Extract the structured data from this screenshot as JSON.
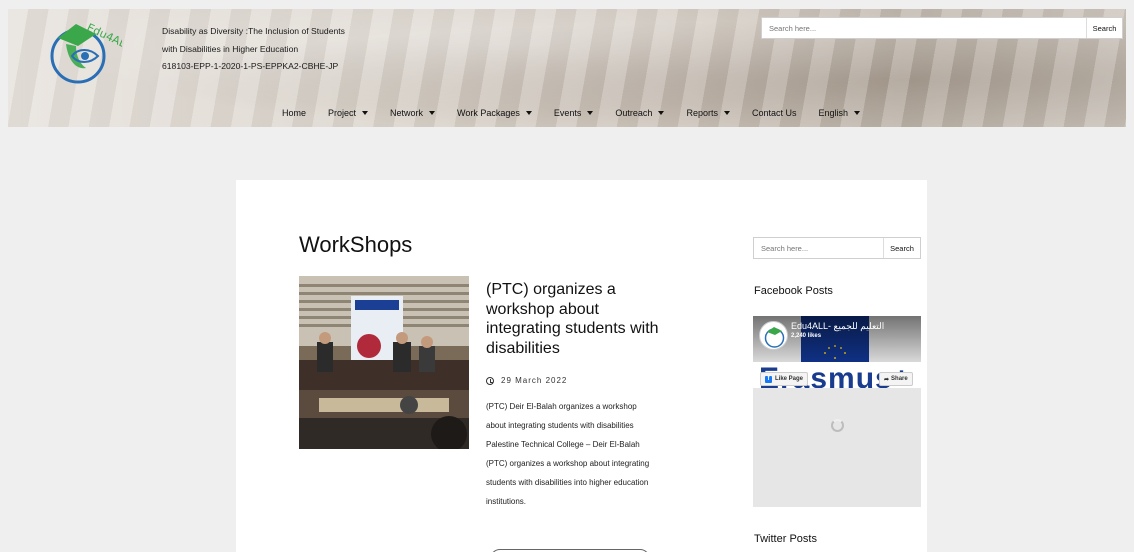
{
  "header": {
    "logo_text": "Edu4ALL",
    "title_lines": [
      "Disability as Diversity :The Inclusion of Students",
      "with Disabilities in Higher Education",
      "618103-EPP-1-2020-1-PS-EPPKA2-CBHE-JP"
    ],
    "search": {
      "placeholder": "Search here...",
      "button": "Search"
    }
  },
  "nav": {
    "items": [
      {
        "label": "Home",
        "dropdown": false
      },
      {
        "label": "Project",
        "dropdown": true
      },
      {
        "label": "Network",
        "dropdown": true
      },
      {
        "label": "Work Packages",
        "dropdown": true
      },
      {
        "label": "Events",
        "dropdown": true
      },
      {
        "label": "Outreach",
        "dropdown": true
      },
      {
        "label": "Reports",
        "dropdown": true
      },
      {
        "label": "Contact Us",
        "dropdown": false
      },
      {
        "label": "English",
        "dropdown": true
      }
    ]
  },
  "main": {
    "page_title": "WorkShops",
    "post": {
      "title": "(PTC) organizes a workshop about integrating students with disabilities",
      "date": "29 March 2022",
      "excerpt": "(PTC) Deir El-Balah organizes a workshop about integrating students with disabilities Palestine Technical College – Deir El-Balah (PTC) organizes a workshop about integrating students with disabilities into higher education institutions."
    }
  },
  "sidebar": {
    "search": {
      "placeholder": "Search here...",
      "button": "Search"
    },
    "facebook_heading": "Facebook Posts",
    "facebook": {
      "page_name": "Edu4ALL- التعليم للجميع",
      "likes": "2,240 likes",
      "cover_text": "Erasmus+",
      "like_button": "Like Page",
      "share_button": "Share"
    },
    "twitter_heading": "Twitter Posts"
  },
  "colors": {
    "background": "#efefef",
    "card": "#ffffff",
    "facebook_blue": "#1877f2",
    "eu_blue": "#12399b",
    "logo_green": "#3aa84a",
    "logo_blue": "#2a6fb5"
  }
}
